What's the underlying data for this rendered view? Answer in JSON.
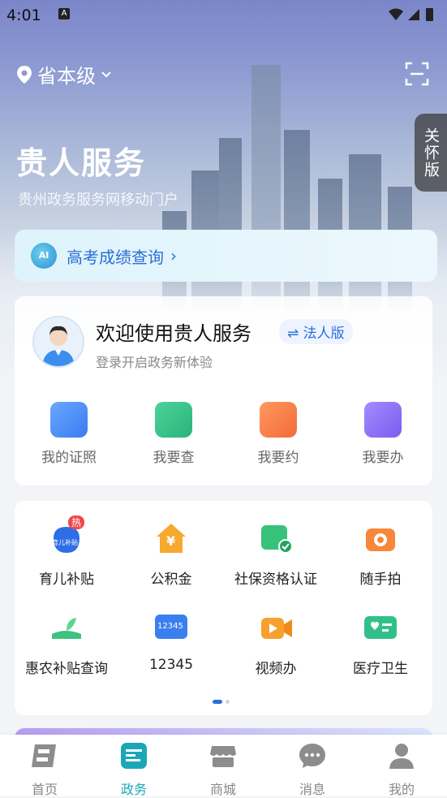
{
  "status": {
    "time": "4:01",
    "indicator": "A"
  },
  "header": {
    "location": "省本级",
    "care_label": "关怀版",
    "title": "贵人服务",
    "subtitle": "贵州政务服务网移动门户"
  },
  "banner": {
    "icon_text": "AI",
    "label": "高考成绩查询",
    "chevron": "›"
  },
  "welcome": {
    "title": "欢迎使用贵人服务",
    "badge": "法人版",
    "hint": "登录开启政务新体验"
  },
  "quick_actions": [
    {
      "label": "我的证照",
      "color": "#3b7bf0"
    },
    {
      "label": "我要查",
      "color": "#27b37a"
    },
    {
      "label": "我要约",
      "color": "#f26a3d"
    },
    {
      "label": "我要办",
      "color": "#7a5cf0"
    }
  ],
  "services": [
    {
      "label": "育儿补贴",
      "hot": "热",
      "icon_text": "育儿补贴"
    },
    {
      "label": "公积金",
      "icon_text": "¥"
    },
    {
      "label": "社保资格认证"
    },
    {
      "label": "随手拍"
    },
    {
      "label": "惠农补贴查询"
    },
    {
      "label": "12345",
      "icon_text": "12345"
    },
    {
      "label": "视频办"
    },
    {
      "label": "医疗卫生"
    }
  ],
  "tabbar": [
    {
      "label": "首页",
      "active": false
    },
    {
      "label": "政务",
      "active": true
    },
    {
      "label": "商城",
      "active": false
    },
    {
      "label": "消息",
      "active": false
    },
    {
      "label": "我的",
      "active": false
    }
  ]
}
